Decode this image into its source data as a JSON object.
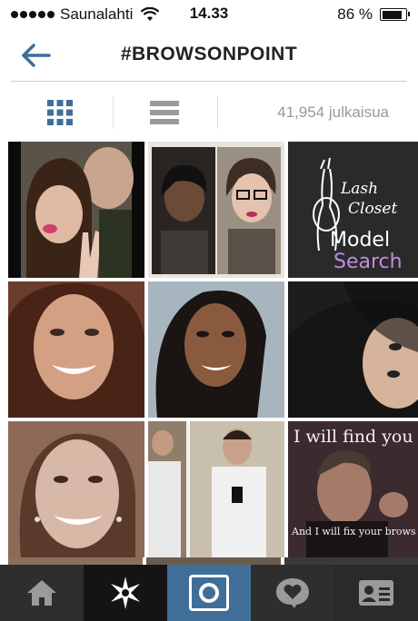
{
  "status_bar": {
    "carrier": "Saunalahti",
    "time": "14.33",
    "battery": "86 %",
    "battery_level": 0.86
  },
  "header": {
    "title": "#BROWSONPOINT",
    "back_icon": "arrow-left-icon"
  },
  "toolbar": {
    "grid_icon": "grid-view-icon",
    "list_icon": "list-view-icon",
    "post_count": "41,954 julkaisua"
  },
  "posts": [
    {
      "kind": "photo",
      "desc": "couple selfie"
    },
    {
      "kind": "photo",
      "desc": "two selfies collage"
    },
    {
      "kind": "logo",
      "line1": "Lash",
      "line2": "Closet",
      "line3": "Model",
      "line4": "Search"
    },
    {
      "kind": "photo",
      "desc": "smiling woman"
    },
    {
      "kind": "photo",
      "desc": "woman with braid"
    },
    {
      "kind": "photo",
      "desc": "woman dark hair"
    },
    {
      "kind": "photo",
      "desc": "woman smiling close-up"
    },
    {
      "kind": "photo",
      "desc": "mirror selfie"
    },
    {
      "kind": "meme",
      "top_text": "I will find you",
      "bottom_text": "And I will fix your brows"
    }
  ],
  "tab_bar": {
    "tabs": [
      {
        "name": "home",
        "icon": "home-icon"
      },
      {
        "name": "explore",
        "icon": "explore-star-icon"
      },
      {
        "name": "camera",
        "icon": "camera-icon",
        "active": true
      },
      {
        "name": "news",
        "icon": "heart-bubble-icon"
      },
      {
        "name": "profile",
        "icon": "profile-card-icon"
      }
    ]
  },
  "colors": {
    "accent": "#3f6f99",
    "tabbar": "#2a2a2a",
    "muted_text": "#999999"
  }
}
